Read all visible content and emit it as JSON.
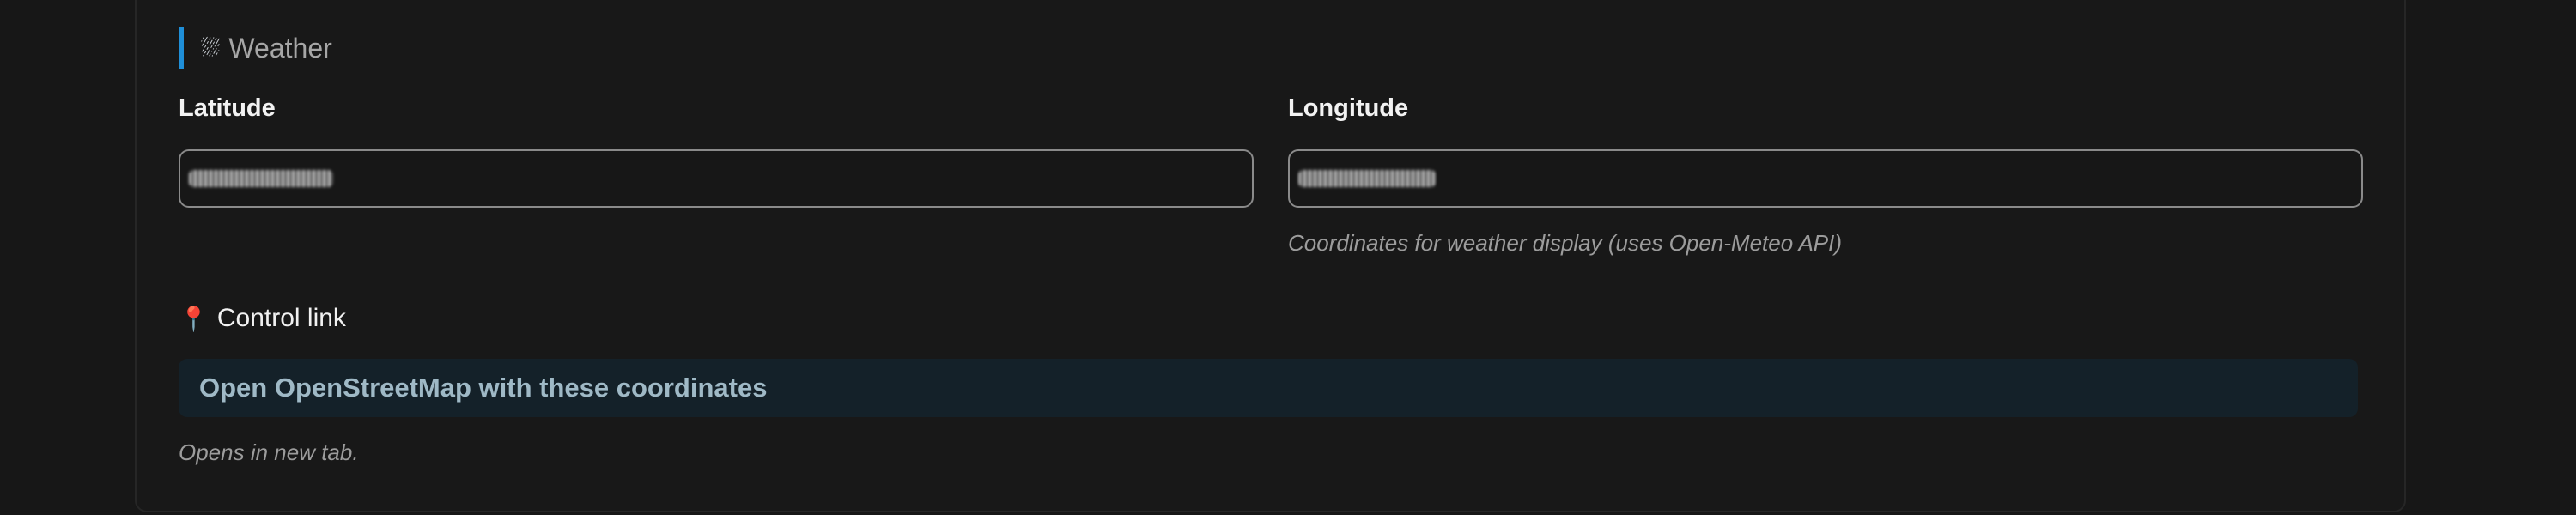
{
  "section": {
    "icon": "⛆",
    "icon_name": "weather-cloud-rain-icon",
    "title": "Weather",
    "accent_color": "#1f8fd8"
  },
  "latitude": {
    "label": "Latitude",
    "value": ""
  },
  "longitude": {
    "label": "Longitude",
    "value": "",
    "hint": "Coordinates for weather display (uses Open-Meteo API)"
  },
  "control": {
    "pin_icon": "📍",
    "pin_icon_name": "map-pin-icon",
    "heading": "Control link",
    "link_label": "Open OpenStreetMap with these coordinates",
    "note": "Opens in new tab."
  }
}
